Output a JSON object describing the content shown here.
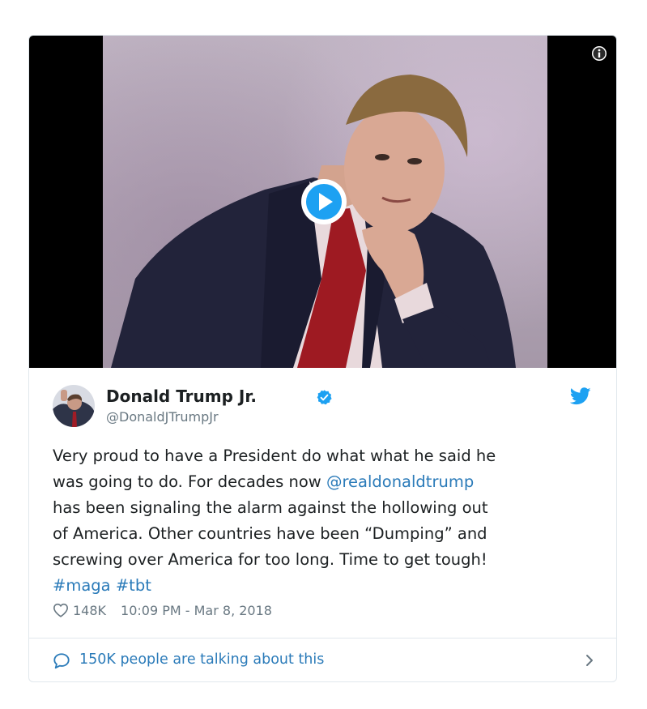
{
  "media": {
    "info_icon": "info-icon",
    "play_icon": "play-icon"
  },
  "author": {
    "name": "Donald Trump Jr.",
    "handle": "@DonaldJTrumpJr",
    "verified_icon": "verified-badge-icon",
    "platform_icon": "twitter-bird-icon"
  },
  "tweet": {
    "lines": [
      [
        {
          "text": "Very proud to have a President do what what he said he"
        }
      ],
      [
        {
          "text": "was going to do. For decades now "
        },
        {
          "text": "@realdonaldtrump",
          "link": true
        }
      ],
      [
        {
          "text": "has been signaling the alarm against the hollowing out"
        }
      ],
      [
        {
          "text": "of America. Other countries have been “Dumping” and"
        }
      ],
      [
        {
          "text": "screwing over America for too long. Time to get tough!"
        }
      ],
      [
        {
          "text": "#maga",
          "link": true
        },
        {
          "text": " "
        },
        {
          "text": "#tbt",
          "link": true
        }
      ]
    ]
  },
  "meta": {
    "likes": "148K",
    "timestamp": "10:09 PM - Mar 8, 2018",
    "heart_icon": "heart-icon"
  },
  "footer": {
    "talking_label": "150K people are talking about this",
    "bubble_icon": "speech-bubble-icon",
    "chevron_icon": "chevron-right-icon"
  },
  "colors": {
    "link": "#2b7bb9",
    "muted": "#697882",
    "twitter_blue": "#1da1f2",
    "border": "#e1e8ed"
  }
}
